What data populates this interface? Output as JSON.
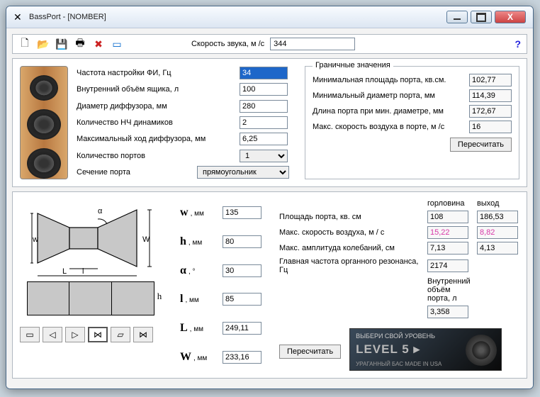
{
  "title": "BassPort - [NOMBER]",
  "toolbar": {
    "icons": {
      "new": "new-file-icon",
      "open": "open-folder-icon",
      "save": "save-icon",
      "print": "print-icon",
      "del": "delete-icon",
      "disp": "display-icon"
    },
    "speed_label": "Скорость звука, м /с",
    "speed_value": "344",
    "help": "?"
  },
  "params": {
    "fi_label": "Частота настройки ФИ, Гц",
    "fi_value": "34",
    "vol_label": "Внутренний объём ящика, л",
    "vol_value": "100",
    "diam_label": "Диаметр диффузора, мм",
    "diam_value": "280",
    "nwoof_label": "Количество НЧ динамиков",
    "nwoof_value": "2",
    "xmax_label": "Максимальный ход диффузора, мм",
    "xmax_value": "6,25",
    "nports_label": "Количество портов",
    "nports_value": "1",
    "section_label": "Сечение порта",
    "section_value": "прямоугольник"
  },
  "boundary": {
    "title": "Граничные значения",
    "area_label": "Минимальная площадь порта, кв.см.",
    "area_value": "102,77",
    "mindiam_label": "Минимальный диаметр порта, мм",
    "mindiam_value": "114,39",
    "len_label": "Длина порта при мин. диаметре, мм",
    "len_value": "172,67",
    "maxv_label": "Макс. скорость воздуха в порте, м /с",
    "maxv_value": "16",
    "recalc": "Пересчитать"
  },
  "dims": {
    "w": {
      "k": "w",
      "u": ", мм",
      "v": "135"
    },
    "h": {
      "k": "h",
      "u": ", мм",
      "v": "80"
    },
    "a": {
      "k": "α",
      "u": ", °",
      "v": "30"
    },
    "l": {
      "k": "l",
      "u": ", мм",
      "v": "85"
    },
    "L": {
      "k": "L",
      "u": ", мм",
      "v": "249,11"
    },
    "W": {
      "k": "W",
      "u": ", мм",
      "v": "233,16"
    }
  },
  "results": {
    "col1": "горловина",
    "col2": "выход",
    "area_label": "Площадь порта, кв. см",
    "area_1": "108",
    "area_2": "186,53",
    "vel_label": "Макс. скорость воздуха, м / с",
    "vel_1": "15,22",
    "vel_2": "8,82",
    "amp_label": "Макс. амплитуда колебаний, см",
    "amp_1": "7,13",
    "amp_2": "4,13",
    "organ_label": "Главная частота органного резонанса, Гц",
    "organ_v": "2174",
    "vport_label": "Внутренний объём порта, л",
    "vport_v": "3,358",
    "recalc": "Пересчитать"
  },
  "banner": {
    "t1": "ВЫБЕРИ СВОЙ УРОВЕНЬ",
    "t2": "LEVEL 5 ▸",
    "t3": "УРАГАННЫЙ БАС MADE IN USA"
  }
}
